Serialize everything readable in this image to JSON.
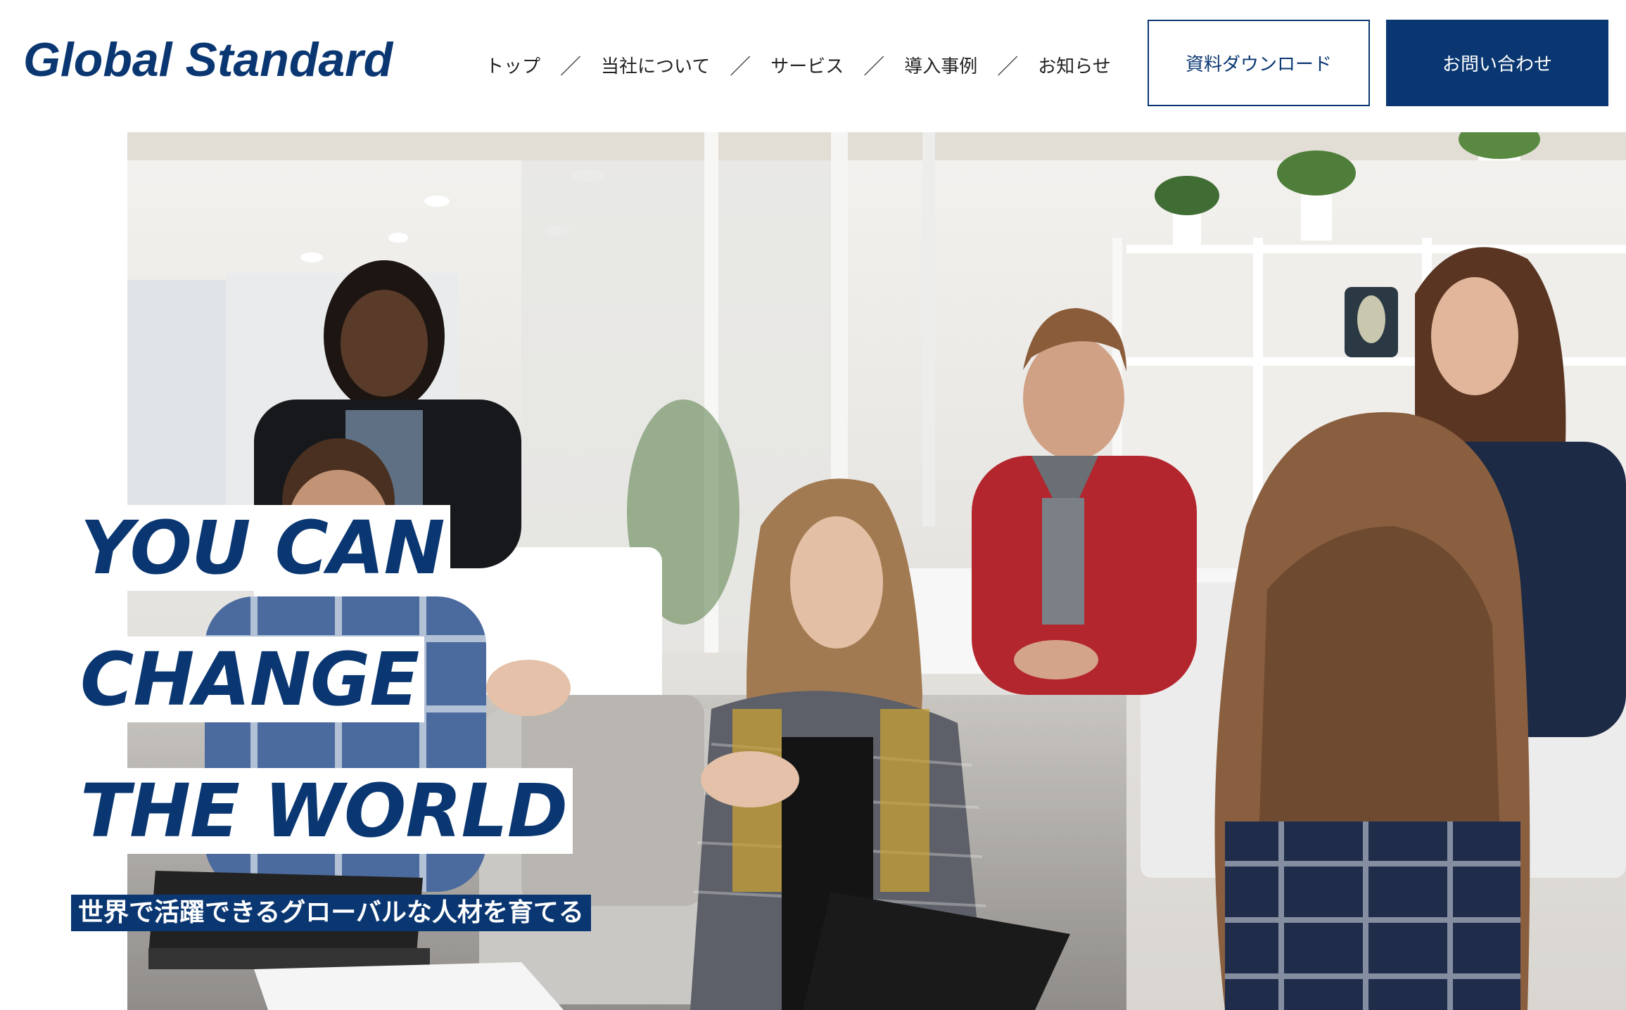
{
  "header": {
    "logo": "Global Standard",
    "nav": [
      "トップ",
      "当社について",
      "サービス",
      "導入事例",
      "お知らせ"
    ],
    "nav_separator": "／",
    "doc_button": "資料ダウンロード",
    "contact_button": "お問い合わせ"
  },
  "hero": {
    "headline": [
      "YOU CAN",
      "CHANGE",
      "THE WORLD"
    ],
    "subtitle": "世界で活躍できるグローバルな人材を育てる"
  },
  "colors": {
    "brand": "#0a3772",
    "background": "#ffffff"
  }
}
